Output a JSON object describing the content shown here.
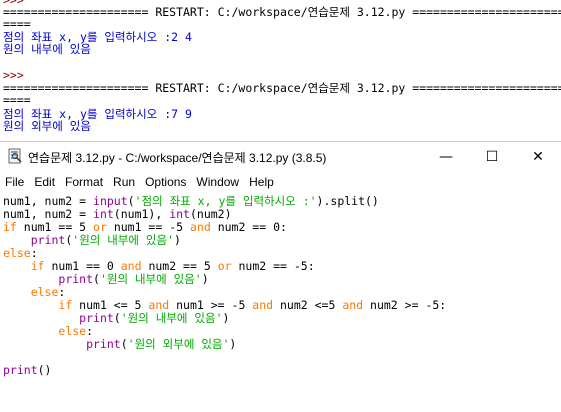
{
  "shell": {
    "lines": [
      {
        "prompt": ">>>"
      },
      {
        "restart": "===================== RESTART: C:/workspace/연습문제 3.12.py ======================"
      },
      {
        "restart": "===="
      },
      {
        "out": "점의 좌표 x, y를 입력하시오 :2 4"
      },
      {
        "out": "원의 내부에 있음"
      },
      {
        "prompt": ""
      },
      {
        "prompt": ">>>"
      },
      {
        "restart": "===================== RESTART: C:/workspace/연습문제 3.12.py ======================"
      },
      {
        "restart": "===="
      },
      {
        "out": "점의 좌표 x, y를 입력하시오 :7 9"
      },
      {
        "out": "원의 외부에 있음"
      }
    ]
  },
  "window": {
    "title": "연습문제 3.12.py - C:/workspace/연습문제 3.12.py (3.8.5)",
    "minimize": "—",
    "maximize": "☐",
    "close": "✕",
    "menu": [
      "File",
      "Edit",
      "Format",
      "Run",
      "Options",
      "Window",
      "Help"
    ]
  },
  "code": {
    "l1a": "num1, num2 = ",
    "l1b": "input",
    "l1c": "(",
    "l1d": "'점의 좌표 x, y를 입력하시오 :'",
    "l1e": ").split()",
    "l2a": "num1, num2 = ",
    "l2b": "int",
    "l2c": "(num1), ",
    "l2d": "int",
    "l2e": "(num2)",
    "l3a": "if",
    "l3b": " num1 == 5 ",
    "l3c": "or",
    "l3d": " num1 == -5 ",
    "l3e": "and",
    "l3f": " num2 == 0:",
    "l4a": "    ",
    "l4b": "print",
    "l4c": "(",
    "l4d": "'원의 내부에 있음'",
    "l4e": ")",
    "l5a": "else",
    "l5b": ":",
    "l6a": "    ",
    "l6b": "if",
    "l6c": " num1 == 0 ",
    "l6d": "and",
    "l6e": " num2 == 5 ",
    "l6f": "or",
    "l6g": " num2 == -5:",
    "l7a": "        ",
    "l7b": "print",
    "l7c": "(",
    "l7d": "'원의 내부에 있음'",
    "l7e": ")",
    "l8a": "    ",
    "l8b": "else",
    "l8c": ":",
    "l9a": "        ",
    "l9b": "if",
    "l9c": " num1 <= 5 ",
    "l9d": "and",
    "l9e": " num1 >= -5 ",
    "l9f": "and",
    "l9g": " num2 <=5 ",
    "l9h": "and",
    "l9i": " num2 >= -5:",
    "l10a": "           ",
    "l10b": "print",
    "l10c": "(",
    "l10d": "'원의 내부에 있음'",
    "l10e": ")",
    "l11a": "        ",
    "l11b": "else",
    "l11c": ":",
    "l12a": "            ",
    "l12b": "print",
    "l12c": "(",
    "l12d": "'원의 외부에 있음'",
    "l12e": ")",
    "l14a": "print",
    "l14b": "()"
  },
  "colors": {
    "keyword": "#ff7700",
    "builtin": "#900090",
    "string": "#00aa00",
    "shell_output": "#0000cd",
    "shell_prompt": "#8b0000"
  }
}
